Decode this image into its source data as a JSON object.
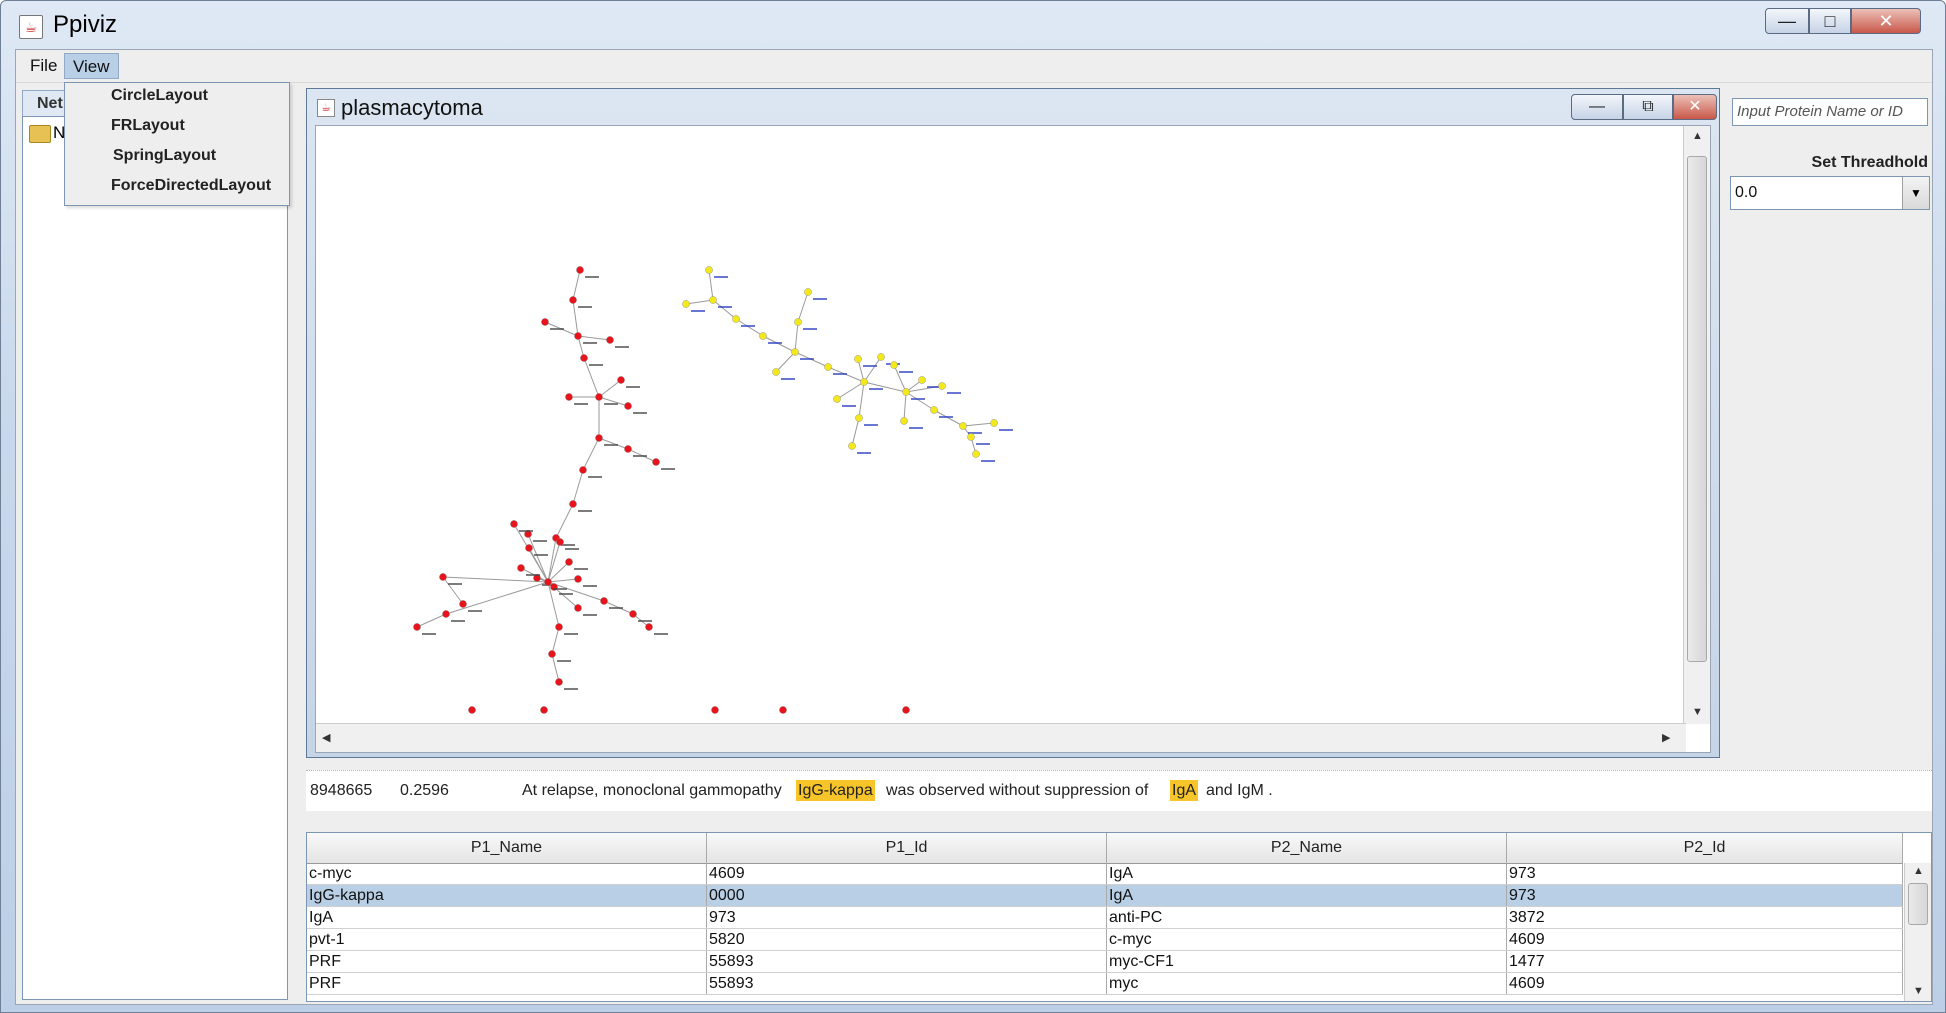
{
  "window": {
    "title": "Ppiviz",
    "minimize": "—",
    "maximize": "□",
    "close": "✕"
  },
  "menubar": {
    "items": [
      {
        "label": "File"
      },
      {
        "label": "View"
      }
    ]
  },
  "view_menu": {
    "items": [
      "CircleLayout",
      "FRLayout",
      "SpringLayout",
      "ForceDirectedLayout"
    ]
  },
  "left_panel": {
    "tab_label": "Net",
    "tree_item_label": "N"
  },
  "internal_frame": {
    "title": "plasmacytoma",
    "minimize": "—",
    "maximize": "⧉",
    "close": "✕"
  },
  "graph": {
    "red_node_color": "#e8141b",
    "yellow_node_color": "#f2e81c",
    "edge_color": "#9a9a9a",
    "red_label_color": "#444444",
    "yellow_label_color": "#2b3cc2"
  },
  "right_panel": {
    "search_placeholder": "Input Protein Name or ID",
    "threshold_label": "Set Threadhold",
    "threshold_value": "0.0"
  },
  "sentence": {
    "pmid": "8948665",
    "score": "0.2596",
    "text_before": "At relapse, monoclonal gammopathy",
    "highlight1": "IgG-kappa",
    "text_middle": "was observed without suppression of",
    "highlight2": "IgA",
    "text_after": "and IgM .",
    "highlight_color": "#f7c42a"
  },
  "table": {
    "columns": [
      "P1_Name",
      "P1_Id",
      "P2_Name",
      "P2_Id"
    ],
    "rows": [
      [
        "c-myc",
        "4609",
        "IgA",
        "973"
      ],
      [
        "IgG-kappa",
        "0000",
        "IgA",
        "973"
      ],
      [
        "IgA",
        "973",
        "anti-PC",
        "3872"
      ],
      [
        "pvt-1",
        "5820",
        "c-myc",
        "4609"
      ],
      [
        "PRF",
        "55893",
        "myc-CF1",
        "1477"
      ],
      [
        "PRF",
        "55893",
        "myc",
        "4609"
      ]
    ],
    "selected_row": 1
  }
}
